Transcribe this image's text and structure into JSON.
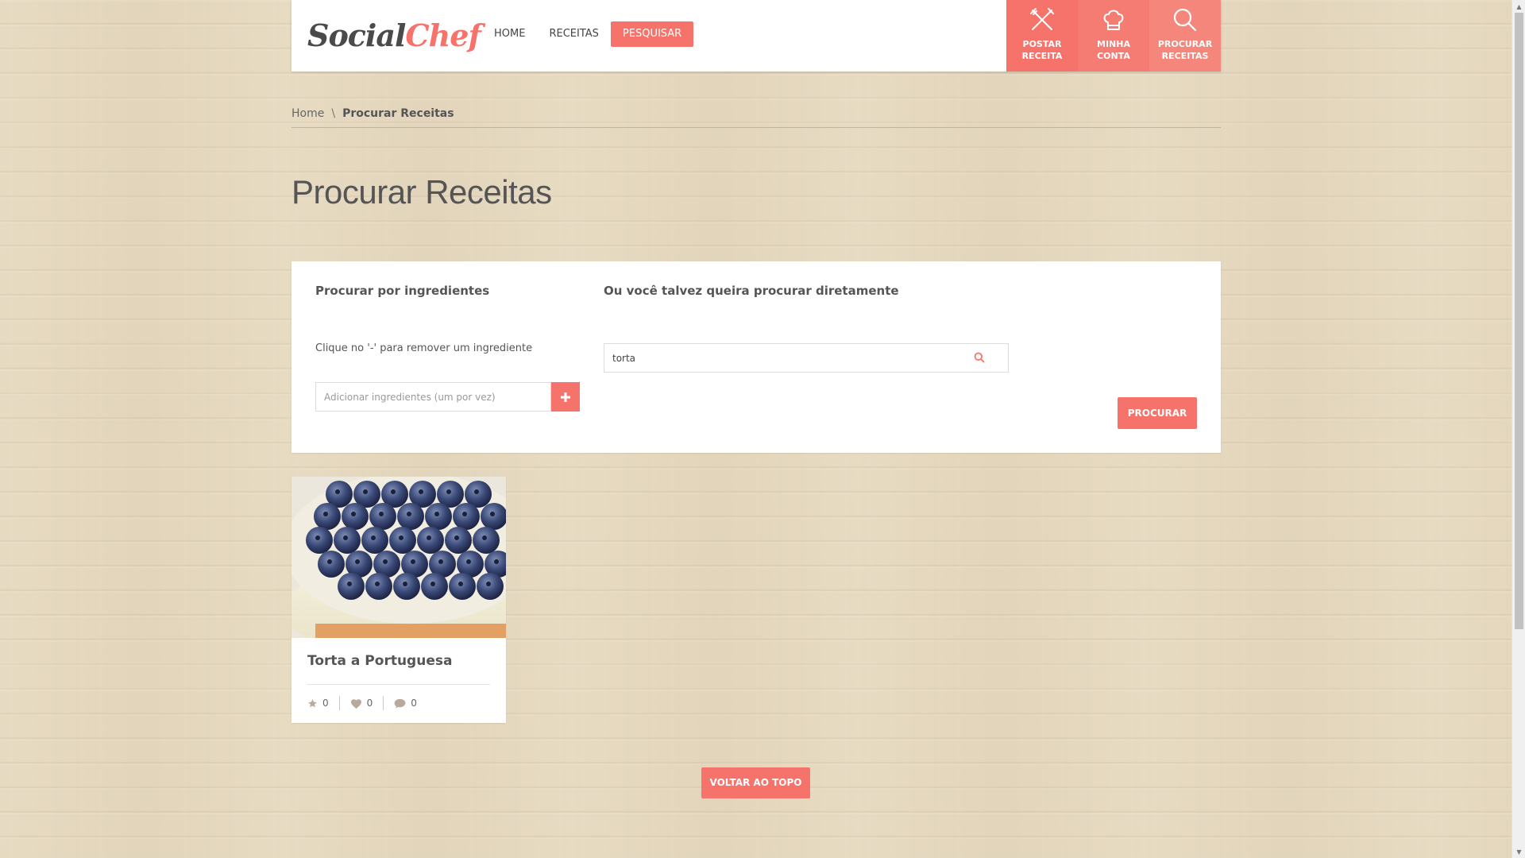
{
  "header": {
    "logo": {
      "part1": "Social",
      "part2": "Chef"
    },
    "nav": [
      {
        "label": "HOME"
      },
      {
        "label": "RECEITAS"
      },
      {
        "label": "PESQUISAR"
      }
    ],
    "quick_buttons": [
      {
        "line1": "POSTAR",
        "line2": "RECEITA",
        "icon": "fork-knife-icon"
      },
      {
        "line1": "MINHA",
        "line2": "CONTA",
        "icon": "chef-hat-icon"
      },
      {
        "line1": "PROCURAR",
        "line2": "RECEITAS",
        "icon": "search-icon"
      }
    ]
  },
  "breadcrumb": {
    "home": "Home",
    "separator": "\\",
    "current": "Procurar Receitas"
  },
  "page_title": "Procurar Receitas",
  "search": {
    "ingredients_heading": "Procurar por ingredientes",
    "ingredients_hint": "Clique no '-' para remover um ingrediente",
    "ingredients_placeholder": "Adicionar ingredientes (um por vez)",
    "direct_heading": "Ou você talvez queira procurar diretamente",
    "direct_value": "torta",
    "submit_label": "PROCURAR"
  },
  "results": [
    {
      "title": "Torta a Portuguesa",
      "rating": "0",
      "likes": "0",
      "comments": "0"
    }
  ],
  "back_to_top": "VOLTAR AO TOPO",
  "colors": {
    "accent": "#f5736a",
    "text": "#555555",
    "panel": "#ffffff"
  }
}
